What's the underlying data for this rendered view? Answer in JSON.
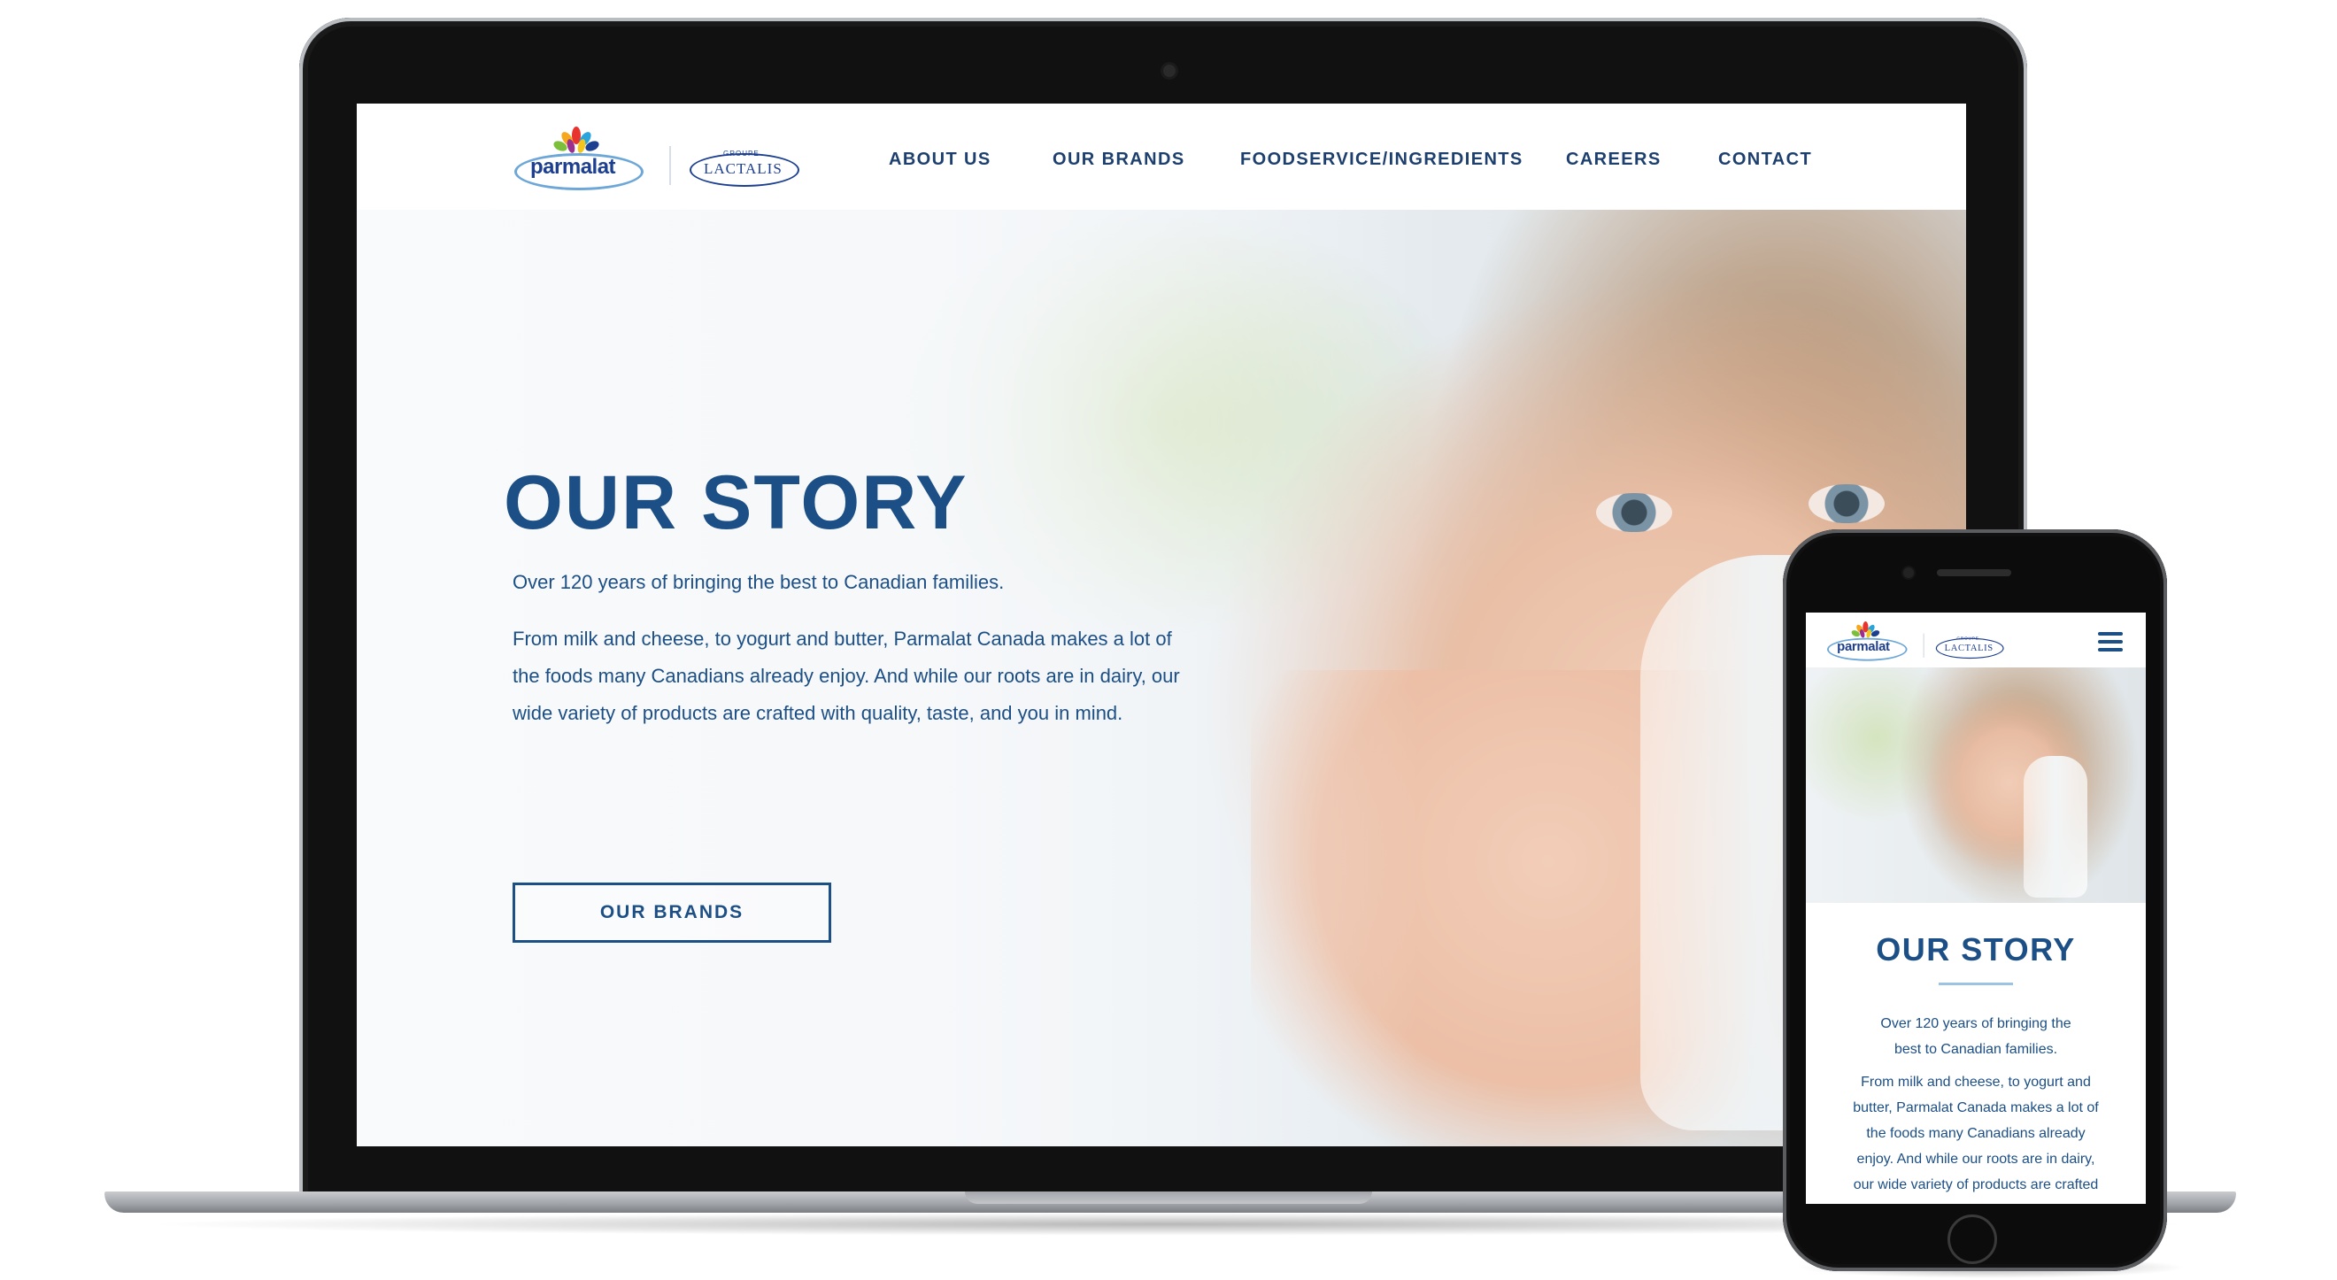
{
  "desktop": {
    "logo": {
      "parmalat": "parmalat",
      "lactalis_groupe": "GROUPE",
      "lactalis": "LACTALIS"
    },
    "nav": [
      {
        "label": "ABOUT US"
      },
      {
        "label": "OUR BRANDS"
      },
      {
        "label": "FOODSERVICE/INGREDIENTS"
      },
      {
        "label": "CAREERS"
      },
      {
        "label": "CONTACT"
      }
    ],
    "hero": {
      "title": "OUR STORY",
      "subtitle": "Over 120 years of bringing the best to Canadian families.",
      "body_lines": [
        "From milk and cheese, to yogurt and butter, Parmalat Canada makes a lot of",
        "the foods many Canadians already enjoy. And while our roots are in dairy, our",
        "wide variety of products are crafted with quality, taste, and you in mind."
      ],
      "button": "OUR BRANDS"
    }
  },
  "mobile": {
    "logo": {
      "parmalat": "parmalat",
      "lactalis_groupe": "GROUPE",
      "lactalis": "LACTALIS"
    },
    "menu_icon": "hamburger-menu-icon",
    "title": "OUR STORY",
    "subtitle_lines": [
      "Over 120 years of bringing the",
      "best to Canadian families."
    ],
    "body_lines": [
      "From milk and cheese, to yogurt and",
      "butter, Parmalat Canada makes a lot of",
      "the foods many Canadians already",
      "enjoy. And while our roots are in dairy,",
      "our wide variety of products are crafted"
    ]
  },
  "colors": {
    "brand_blue": "#1c4f86",
    "nav_text": "#1d3f6e",
    "accent_light_blue": "#9cc3e3"
  }
}
